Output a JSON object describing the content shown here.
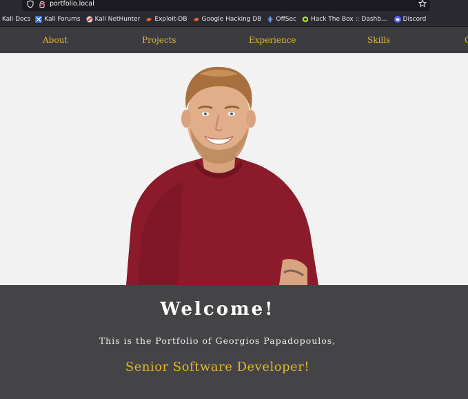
{
  "browser": {
    "url": "portfolio.local",
    "bookmarks": [
      {
        "label": "Kali Docs",
        "icon": "kali-icon"
      },
      {
        "label": "Kali Forums",
        "icon": "kali-forums-icon"
      },
      {
        "label": "Kali NetHunter",
        "icon": "nethunter-icon"
      },
      {
        "label": "Exploit-DB",
        "icon": "exploit-db-icon"
      },
      {
        "label": "Google Hacking DB",
        "icon": "ghdb-icon"
      },
      {
        "label": "OffSec",
        "icon": "offsec-icon"
      },
      {
        "label": "Hack The Box :: Dashb...",
        "icon": "htb-icon"
      },
      {
        "label": "Discord",
        "icon": "discord-icon"
      }
    ]
  },
  "nav": {
    "items": [
      "About",
      "Projects",
      "Experience",
      "Skills",
      "C"
    ]
  },
  "hero": {
    "image": "portrait-photo"
  },
  "welcome": {
    "title": "Welcome!",
    "intro": "This is the Portfolio of Georgios Papadopoulos,",
    "role": "Senior Software Developer!"
  },
  "colors": {
    "accent": "#e0b62d",
    "nav_bg": "#3c3c40",
    "welcome_bg": "#444447",
    "hero_bg": "#f2f2f2",
    "shirt": "#8b1a2b"
  }
}
